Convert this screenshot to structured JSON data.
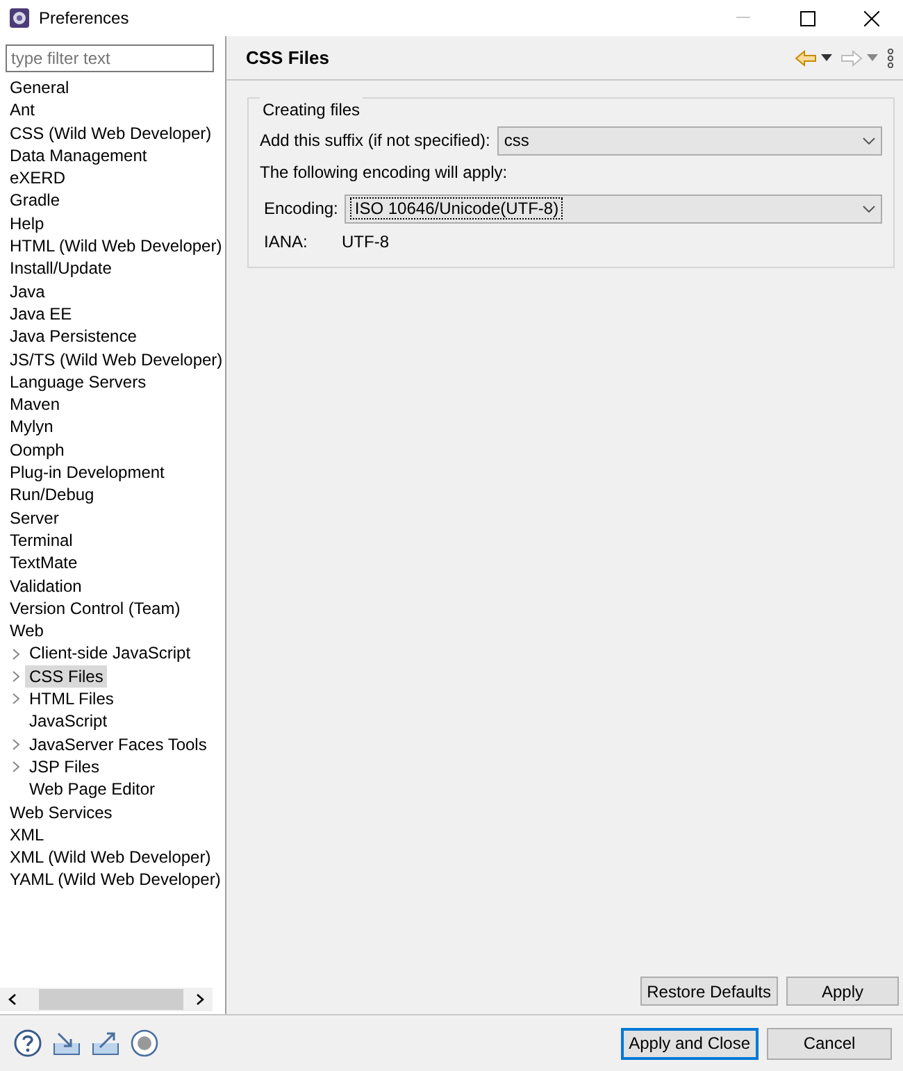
{
  "window": {
    "title": "Preferences"
  },
  "filter": {
    "placeholder": "type filter text"
  },
  "tree": [
    {
      "label": "General",
      "selected": false
    },
    {
      "label": "Ant",
      "selected": false
    },
    {
      "label": "CSS (Wild Web Developer)",
      "selected": false
    },
    {
      "label": "Data Management",
      "selected": false
    },
    {
      "label": "eXERD",
      "selected": false
    },
    {
      "label": "Gradle",
      "selected": false
    },
    {
      "label": "Help",
      "selected": false
    },
    {
      "label": "HTML (Wild Web Developer)",
      "selected": false
    },
    {
      "label": "Install/Update",
      "selected": false
    },
    {
      "label": "Java",
      "selected": false
    },
    {
      "label": "Java EE",
      "selected": false
    },
    {
      "label": "Java Persistence",
      "selected": false
    },
    {
      "label": "JS/TS (Wild Web Developer)",
      "selected": false
    },
    {
      "label": "Language Servers",
      "selected": false
    },
    {
      "label": "Maven",
      "selected": false
    },
    {
      "label": "Mylyn",
      "selected": false
    },
    {
      "label": "Oomph",
      "selected": false
    },
    {
      "label": "Plug-in Development",
      "selected": false
    },
    {
      "label": "Run/Debug",
      "selected": false
    },
    {
      "label": "Server",
      "selected": false
    },
    {
      "label": "Terminal",
      "selected": false
    },
    {
      "label": "TextMate",
      "selected": false
    },
    {
      "label": "Validation",
      "selected": false
    },
    {
      "label": "Version Control (Team)",
      "selected": false
    },
    {
      "label": "Web",
      "selected": false,
      "children": [
        {
          "label": "Client-side JavaScript",
          "selected": false,
          "expandable": true
        },
        {
          "label": "CSS Files",
          "selected": true,
          "expandable": true
        },
        {
          "label": "HTML Files",
          "selected": false,
          "expandable": true
        },
        {
          "label": "JavaScript",
          "selected": false,
          "expandable": false
        },
        {
          "label": "JavaServer Faces Tools",
          "selected": false,
          "expandable": true
        },
        {
          "label": "JSP Files",
          "selected": false,
          "expandable": true
        },
        {
          "label": "Web Page Editor",
          "selected": false,
          "expandable": false
        }
      ]
    },
    {
      "label": "Web Services",
      "selected": false
    },
    {
      "label": "XML",
      "selected": false
    },
    {
      "label": "XML (Wild Web Developer)",
      "selected": false
    },
    {
      "label": "YAML (Wild Web Developer)",
      "selected": false
    }
  ],
  "page": {
    "title": "CSS Files",
    "group": {
      "title": "Creating files",
      "suffix": {
        "label": "Add this suffix (if not specified):",
        "value": "css"
      },
      "note": "The following encoding will apply:",
      "encoding": {
        "label": "Encoding:",
        "value": "ISO 10646/Unicode(UTF-8)"
      },
      "iana": {
        "label": "IANA:",
        "value": "UTF-8"
      }
    },
    "buttons": [
      "Restore Defaults",
      "Apply"
    ]
  },
  "footer": {
    "buttons": [
      {
        "label": "Apply and Close",
        "default": true
      },
      {
        "label": "Cancel",
        "default": false
      }
    ]
  }
}
